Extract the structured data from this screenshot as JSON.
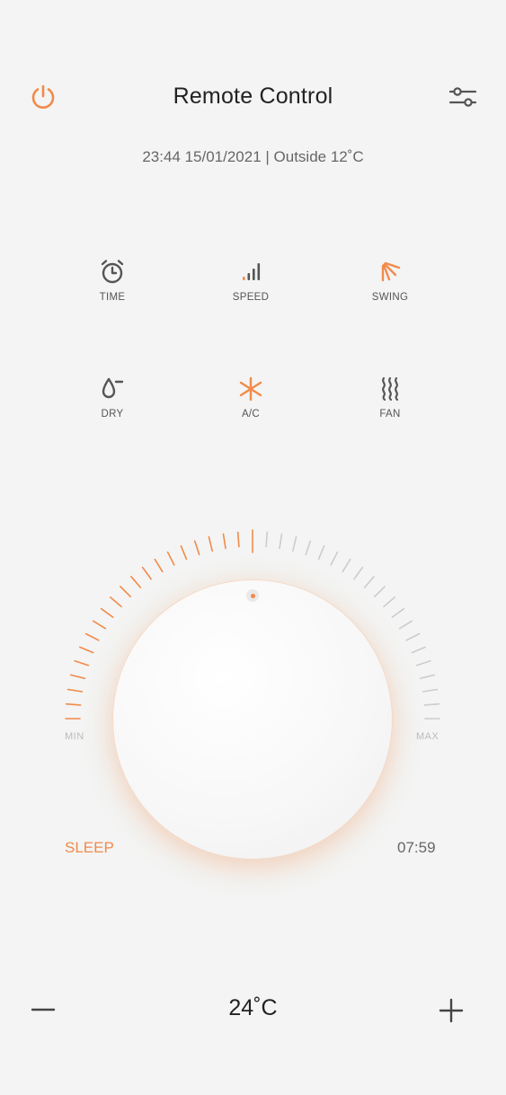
{
  "header": {
    "title": "Remote Control"
  },
  "status": {
    "line": "23:44 15/01/2021 | Outside 12˚C"
  },
  "modes": [
    {
      "id": "time",
      "label": "TIME",
      "icon": "alarm-clock-icon",
      "active": false
    },
    {
      "id": "speed",
      "label": "SPEED",
      "icon": "signal-bars-icon",
      "active": false
    },
    {
      "id": "swing",
      "label": "SWING",
      "icon": "swing-icon",
      "active": true
    },
    {
      "id": "dry",
      "label": "DRY",
      "icon": "droplet-icon",
      "active": false
    },
    {
      "id": "ac",
      "label": "A/C",
      "icon": "snowflake-icon",
      "active": true
    },
    {
      "id": "fan",
      "label": "FAN",
      "icon": "heat-waves-icon",
      "active": false
    }
  ],
  "dial": {
    "min_label": "MIN",
    "max_label": "MAX",
    "level_fraction": 0.5,
    "sleep_label": "SLEEP",
    "timer_value": "07:59"
  },
  "temperature": {
    "value": "24˚C"
  },
  "colors": {
    "accent": "#f28a4a",
    "text": "#222222",
    "muted": "#666666",
    "background": "#f3f4f3",
    "inactive_tick": "#cccccc"
  }
}
